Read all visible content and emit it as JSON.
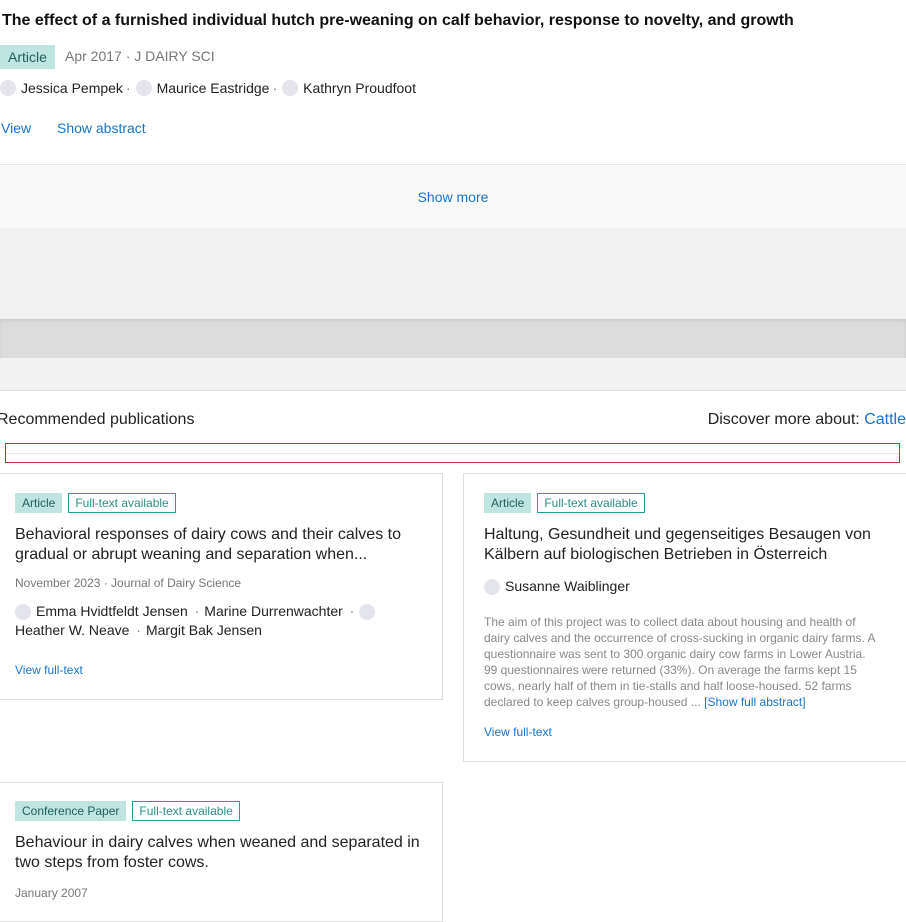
{
  "article": {
    "title": "The effect of a furnished individual hutch pre-weaning on calf behavior, response to novelty, and growth",
    "type": "Article",
    "meta": "Apr 2017 · J DAIRY SCI",
    "authors": [
      "Jessica Pempek",
      "Maurice Eastridge",
      "Kathryn Proudfoot"
    ],
    "actions": [
      "View",
      "Show abstract"
    ]
  },
  "show_more": "Show more",
  "recommended": {
    "heading": "Recommended publications",
    "discover_label": "Discover more about: ",
    "discover_link": "Cattle",
    "cards": [
      {
        "type": "Article",
        "fulltext": "Full-text available",
        "title": "Behavioral responses of dairy cows and their calves to gradual or abrupt weaning and separation when...",
        "meta": "November 2023 · Journal of Dairy Science",
        "authors": [
          "Emma Hvidtfeldt Jensen",
          "Marine Durrenwachter",
          "Heather W. Neave",
          "Margit Bak Jensen"
        ],
        "view": "View full-text"
      },
      {
        "type": "Article",
        "fulltext": "Full-text available",
        "title": "Haltung, Gesundheit und gegenseitiges Besaugen von Kälbern auf biologischen Betrieben in Österreich",
        "authors": [
          "Susanne Waiblinger"
        ],
        "abstract": "The aim of this project was to collect data about housing and health of dairy calves and the occurrence of cross-sucking in organic dairy farms. A questionnaire was sent to 300 organic dairy cow farms in Lower Austria. 99 questionnaires were returned (33%). On average the farms kept 15 cows, nearly half of them in tie-stalls and half loose-housed. 52 farms declared to keep calves group-housed ...",
        "show_full_abstract": "[Show full abstract]",
        "view": "View full-text"
      },
      {
        "type": "Conference Paper",
        "fulltext": "Full-text available",
        "title": "Behaviour in dairy calves when weaned and separated in two steps from foster cows.",
        "meta": "January 2007"
      }
    ]
  }
}
